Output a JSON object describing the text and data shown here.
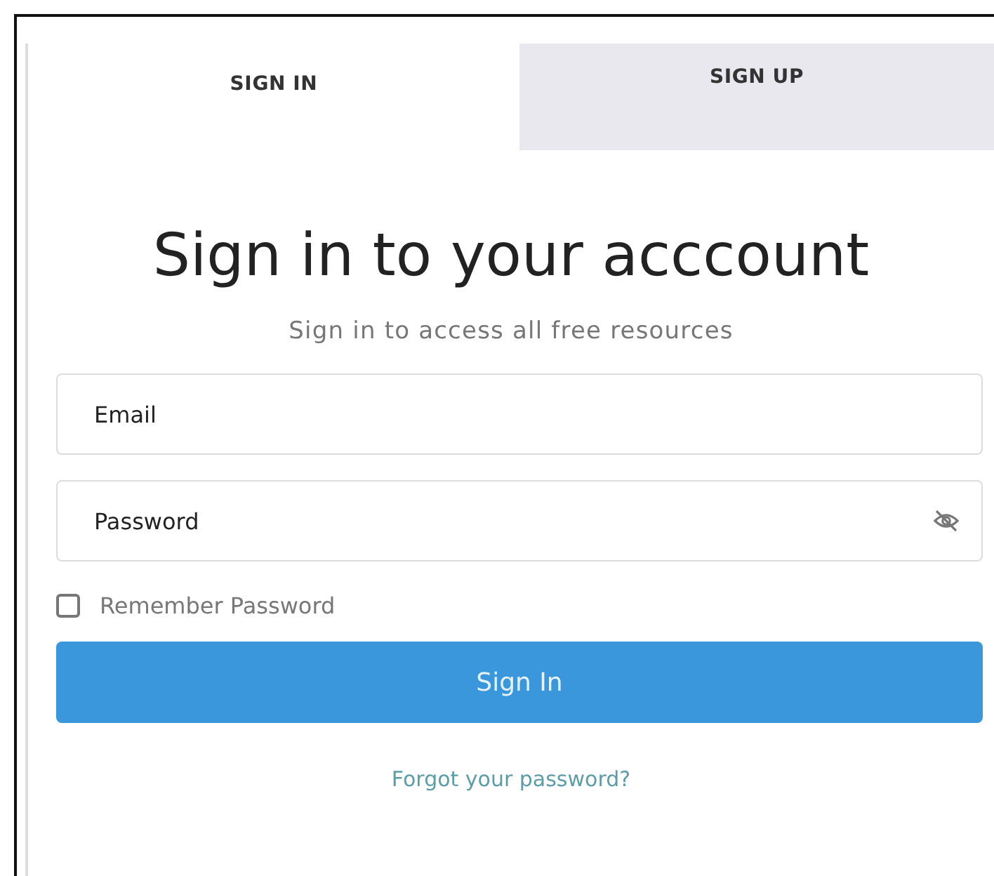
{
  "tabs": [
    {
      "label": "SIGN IN",
      "selected": true
    },
    {
      "label": "SIGN UP",
      "selected": false
    }
  ],
  "heading": "Sign in to your acccount",
  "subheading": "Sign in to access all free resources",
  "fields": [
    {
      "kind": "text",
      "placeholder": "Email"
    },
    {
      "kind": "password",
      "placeholder": "Password"
    }
  ],
  "remember": {
    "label": "Remember Password",
    "checked": false
  },
  "submit_button": "Sign In",
  "forgot_link": "Forgot your password?"
}
